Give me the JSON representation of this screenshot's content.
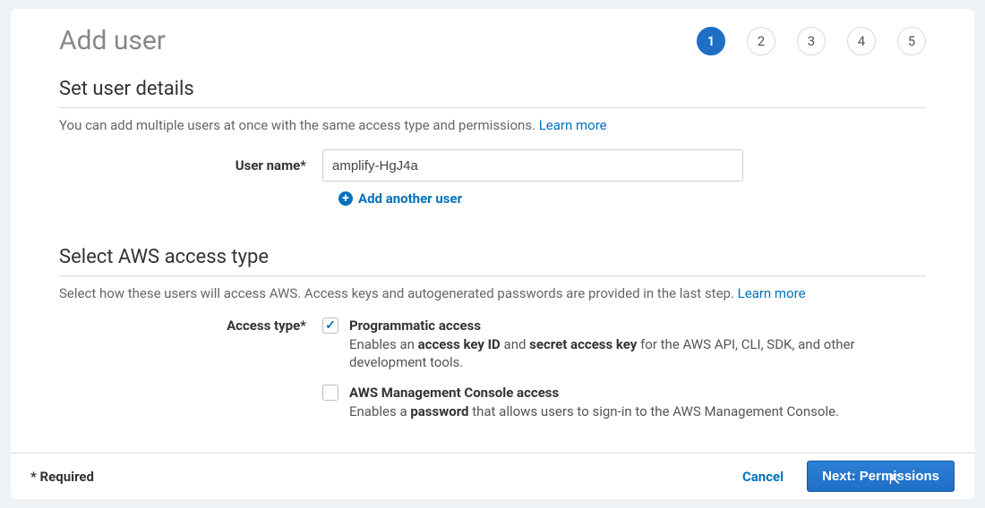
{
  "page": {
    "title": "Add user",
    "required_label": "* Required"
  },
  "wizard": {
    "steps": [
      "1",
      "2",
      "3",
      "4",
      "5"
    ],
    "active_index": 0
  },
  "section_details": {
    "heading": "Set user details",
    "description": "You can add multiple users at once with the same access type and permissions.",
    "learn_more": "Learn more",
    "username_label": "User name*",
    "username_value": "amplify-HgJ4a",
    "add_another": "Add another user"
  },
  "section_access": {
    "heading": "Select AWS access type",
    "description": "Select how these users will access AWS. Access keys and autogenerated passwords are provided in the last step.",
    "learn_more": "Learn more",
    "access_type_label": "Access type*",
    "options": [
      {
        "title": "Programmatic access",
        "desc_prefix": "Enables an ",
        "bold1": "access key ID",
        "mid": " and ",
        "bold2": "secret access key",
        "desc_suffix": " for the AWS API, CLI, SDK, and other development tools.",
        "checked": true
      },
      {
        "title": "AWS Management Console access",
        "desc_prefix": "Enables a ",
        "bold1": "password",
        "mid": "",
        "bold2": "",
        "desc_suffix": " that allows users to sign-in to the AWS Management Console.",
        "checked": false
      }
    ]
  },
  "footer": {
    "cancel": "Cancel",
    "next": "Next: Permissions"
  }
}
